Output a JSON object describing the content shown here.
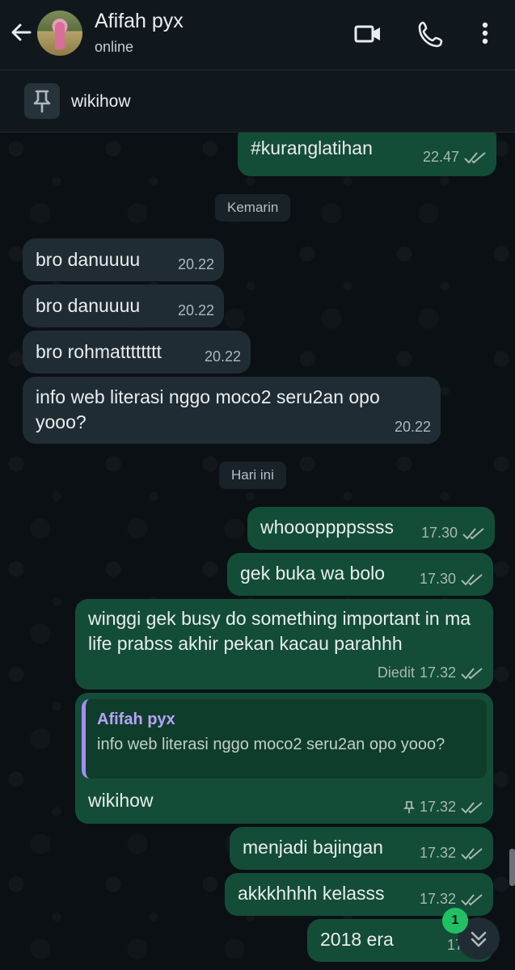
{
  "header": {
    "contact_name": "Afifah pyx",
    "status": "online"
  },
  "pinned": {
    "text": "wikihow"
  },
  "dates": {
    "yesterday": "Kemarin",
    "today": "Hari ini"
  },
  "messages": [
    {
      "text": "#kuranglatihan",
      "time": "22.47",
      "direction": "out"
    },
    {
      "text": "bro danuuuu",
      "time": "20.22",
      "direction": "in"
    },
    {
      "text": "bro danuuuu",
      "time": "20.22",
      "direction": "in"
    },
    {
      "text": "bro rohmatttttttt",
      "time": "20.22",
      "direction": "in"
    },
    {
      "text": "info web literasi nggo moco2 seru2an opo yooo?",
      "time": "20.22",
      "direction": "in"
    },
    {
      "text": "whoooppppssss",
      "time": "17.30",
      "direction": "out"
    },
    {
      "text": "gek buka wa bolo",
      "time": "17.30",
      "direction": "out"
    },
    {
      "text": "winggi gek busy do something important in ma life prabss akhir pekan kacau parahhh",
      "time": "17.32",
      "edited": "Diedit",
      "direction": "out"
    },
    {
      "text": "wikihow",
      "time": "17.32",
      "direction": "out",
      "pinned": true,
      "quote": {
        "name": "Afifah pyx",
        "text": "info web literasi nggo moco2 seru2an opo yooo?"
      }
    },
    {
      "text": "menjadi bajingan",
      "time": "17.32",
      "direction": "out"
    },
    {
      "text": "akkkhhhh kelasss",
      "time": "17.32",
      "direction": "out"
    },
    {
      "text": "2018 era",
      "time": "17.32",
      "direction": "out"
    }
  ],
  "unread_badge": "1",
  "colors": {
    "header_bg": "#11181d",
    "incoming_bubble": "#202c33",
    "outgoing_bubble": "#134d37",
    "badge": "#21c063",
    "quote_accent": "#a78bfa"
  },
  "icons": [
    "back-arrow-icon",
    "video-call-icon",
    "phone-icon",
    "more-icon",
    "pin-icon",
    "double-check-icon",
    "chevron-down-icon"
  ]
}
